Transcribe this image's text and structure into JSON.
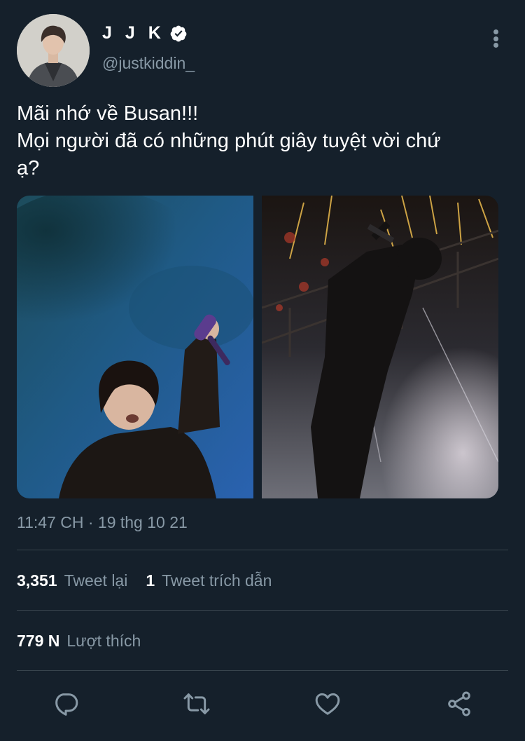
{
  "user": {
    "display_name": "J J K",
    "handle": "@justkiddin_",
    "verified": true
  },
  "tweet": {
    "lines": [
      "Mãi nhớ về Busan!!!",
      "Mọi người đã có những phút giây tuyệt vời chứ",
      "ạ?"
    ],
    "timestamp": "11:47 CH · 19 thg 10 21",
    "media": [
      {
        "icon": "concert-photo-blue-stage"
      },
      {
        "icon": "concert-photo-fireworks"
      }
    ]
  },
  "stats": {
    "retweets_count": "3,351",
    "retweets_label": "Tweet lại",
    "quotes_count": "1",
    "quotes_label": "Tweet trích dẫn",
    "likes_count": "779 N",
    "likes_label": "Lượt thích"
  },
  "actions": [
    {
      "name": "reply",
      "icon": "reply-icon"
    },
    {
      "name": "retweet",
      "icon": "retweet-icon"
    },
    {
      "name": "like",
      "icon": "heart-icon"
    },
    {
      "name": "share",
      "icon": "share-icon"
    }
  ],
  "colors": {
    "background": "#15202b",
    "text_primary": "#ffffff",
    "text_secondary": "#8899a6",
    "divider": "#38444d"
  }
}
